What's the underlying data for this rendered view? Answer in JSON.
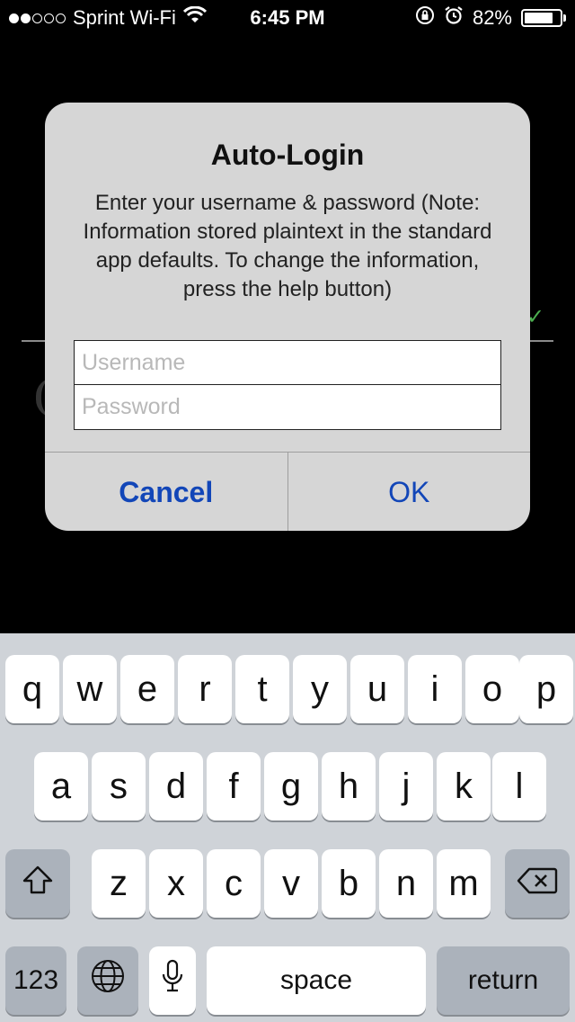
{
  "status_bar": {
    "carrier": "Sprint Wi-Fi",
    "time": "6:45 PM",
    "battery_percent": "82%",
    "battery_level": 0.82,
    "signal_bars_filled": 2,
    "signal_bars_total": 5,
    "icons": [
      "wifi-icon",
      "rotation-lock-icon",
      "alarm-icon",
      "battery-icon"
    ]
  },
  "alert": {
    "title": "Auto-Login",
    "message": "Enter your username & password (Note: Information stored plaintext in the standard app defaults. To change the information, press the help button)",
    "username_placeholder": "Username",
    "username_value": "",
    "password_placeholder": "Password",
    "password_value": "",
    "cancel_label": "Cancel",
    "ok_label": "OK",
    "button_color": "#1246b8"
  },
  "keyboard": {
    "row1": [
      "q",
      "w",
      "e",
      "r",
      "t",
      "y",
      "u",
      "i",
      "o",
      "p"
    ],
    "row2": [
      "a",
      "s",
      "d",
      "f",
      "g",
      "h",
      "j",
      "k",
      "l"
    ],
    "row3": [
      "z",
      "x",
      "c",
      "v",
      "b",
      "n",
      "m"
    ],
    "numbers_label": "123",
    "space_label": "space",
    "return_label": "return",
    "icons": [
      "shift-icon",
      "backspace-icon",
      "globe-icon",
      "microphone-icon"
    ]
  }
}
